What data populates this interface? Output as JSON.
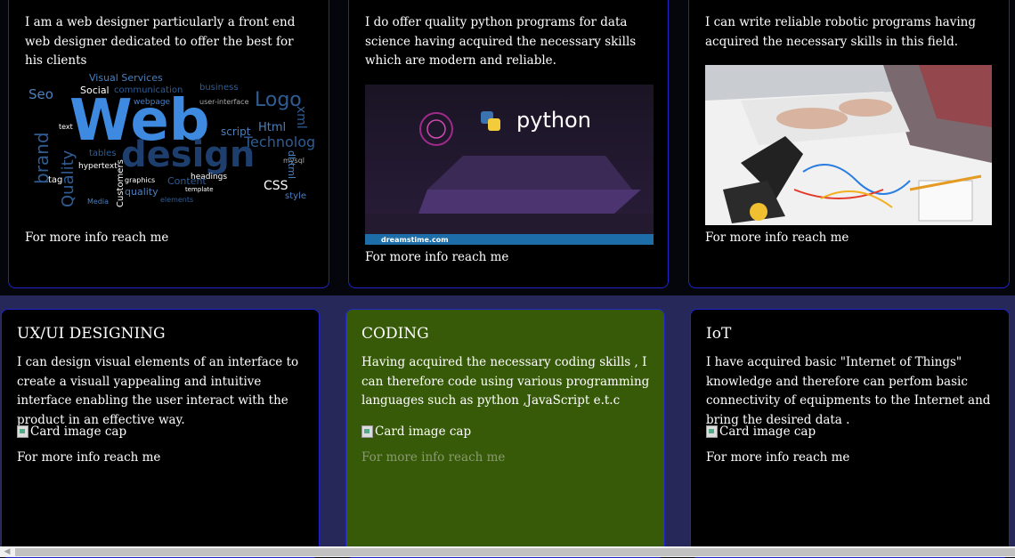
{
  "top_cards": [
    {
      "text": "I am a web designer particularly a front end web designer dedicated to offer the best for his clients",
      "more": "For more info reach me",
      "image_label": "Web design"
    },
    {
      "text": "I do offer quality python programs for data science having acquired the necessary skills which are modern and reliable.",
      "more": "For more info reach me",
      "image_label": "python",
      "image_footer": "dreamstime.com"
    },
    {
      "text": "I can write reliable robotic programs having acquired the necessary skills in this field.",
      "more": "For more info reach me"
    }
  ],
  "bottom_cards": [
    {
      "title": "UX/UI DESIGNING",
      "text": "I can design visual elements of an interface to create a visuall yappealing and intuitive interface enabling the user interact with the product in an effective way.",
      "image_alt": "Card image cap",
      "more": "For more info reach me"
    },
    {
      "title": "CODING",
      "text": "Having acquired the necessary coding skills , I can therefore code using various programming languages such as python ,JavaScript e.t.c",
      "image_alt": "Card image cap",
      "more": "For more info reach me"
    },
    {
      "title": "IoT",
      "text": "I have acquired basic \"Internet of Things\" knowledge and therefore can perfom basic connectivity of equipments to the Internet and bring the desired data .",
      "image_alt": "Card image cap",
      "more": "For more info reach me"
    }
  ],
  "colors": {
    "card_border": "#1f23c8",
    "coding_card_bg": "#375a08",
    "bottom_band": "#26285a"
  }
}
